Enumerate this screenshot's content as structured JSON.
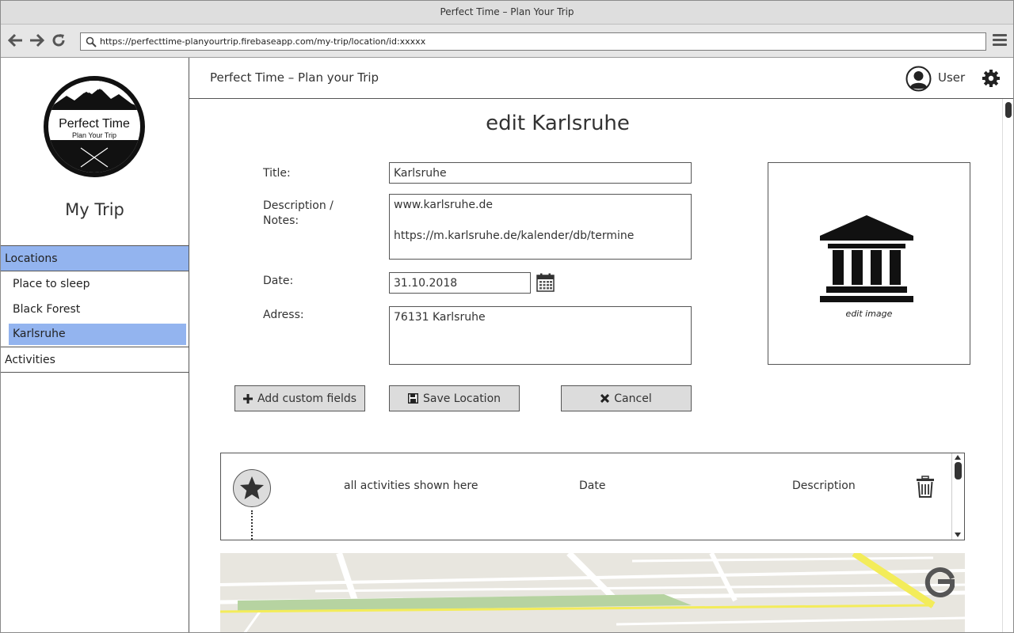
{
  "window": {
    "title": "Perfect Time – Plan Your Trip"
  },
  "browser": {
    "url": "https://perfecttime-planyourtrip.firebaseapp.com/my-trip/location/id:xxxxx"
  },
  "sidebar": {
    "logo": {
      "title": "Perfect Time",
      "subtitle": "Plan Your Trip"
    },
    "heading": "My Trip",
    "sections": [
      {
        "label": "Locations",
        "items": [
          {
            "label": "Place to sleep"
          },
          {
            "label": "Black Forest"
          },
          {
            "label": "Karlsruhe"
          }
        ]
      },
      {
        "label": "Activities"
      }
    ]
  },
  "header": {
    "title": "Perfect Time – Plan your Trip",
    "user_label": "User"
  },
  "form": {
    "heading": "edit Karlsruhe",
    "title_label": "Title:",
    "title_value": "Karlsruhe",
    "description_label": "Description / Notes:",
    "description_value": "www.karlsruhe.de\n\nhttps://m.karlsruhe.de/kalender/db/termine",
    "date_label": "Date:",
    "date_value": "31.10.2018",
    "address_label": "Adress:",
    "address_value": "76131 Karlsruhe",
    "edit_image_label": "edit image"
  },
  "buttons": {
    "add_custom_fields": "Add custom fields",
    "save_location": "Save Location",
    "cancel": "Cancel"
  },
  "activities_list": {
    "columns": [
      "all activities shown here",
      "Date",
      "Description"
    ]
  },
  "colors": {
    "selection": "#93b4ef",
    "button_bg": "#dcdcdc",
    "map_road_highlight": "#f3ec5a",
    "map_park": "#b6d3a1"
  }
}
